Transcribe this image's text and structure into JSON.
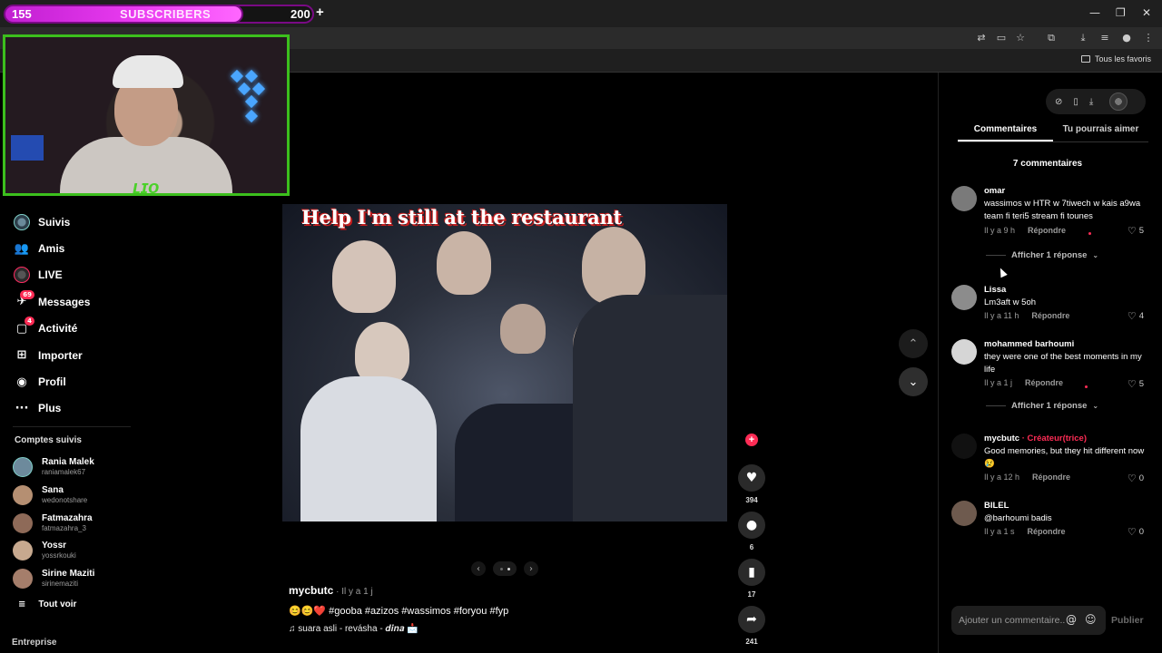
{
  "overlay": {
    "sub_start": "155",
    "sub_label": "SUBSCRIBERS",
    "sub_goal": "200",
    "sub_plus": "+"
  },
  "browser": {
    "bookmark_all": "Tous les favoris",
    "window_controls": [
      "—",
      "❐",
      "✕"
    ]
  },
  "sidebar": {
    "items": [
      {
        "label": "Suivis",
        "icon": "following-avatar-icon"
      },
      {
        "label": "Amis",
        "icon": "friends-icon"
      },
      {
        "label": "LIVE",
        "icon": "live-icon"
      },
      {
        "label": "Messages",
        "icon": "messages-icon",
        "badge": "69"
      },
      {
        "label": "Activité",
        "icon": "activity-icon",
        "badge": "4"
      },
      {
        "label": "Importer",
        "icon": "upload-icon"
      },
      {
        "label": "Profil",
        "icon": "profile-icon"
      },
      {
        "label": "Plus",
        "icon": "more-icon"
      }
    ],
    "following_title": "Comptes suivis",
    "following": [
      {
        "name": "Rania Malek",
        "user": "raniamalek67",
        "color": "#6d8a9c"
      },
      {
        "name": "Sana",
        "user": "wedonotshare",
        "color": "#b58f72"
      },
      {
        "name": "Fatmazahra",
        "user": "fatmazahra_3",
        "color": "#8e6a58"
      },
      {
        "name": "Yossr",
        "user": "yossrkouki",
        "color": "#c7a98f"
      },
      {
        "name": "Sirine Maziti",
        "user": "sirinemaziti",
        "color": "#a57e6b"
      }
    ],
    "see_all": "Tout voir",
    "company": "Entreprise"
  },
  "video": {
    "caption": "Help I'm still at the restaurant",
    "author": "mycbutc",
    "time": " · Il y a 1 j",
    "description": "😊😊❤️ #gooba #azizos #wassimos #foryou #fyp",
    "music": "♫  suara asli - revásha - 𝒅𝒊𝒏𝒂 📩",
    "carousel_prev": "‹",
    "carousel_next": "›",
    "slide": 2,
    "slides": 2
  },
  "actions": {
    "likes": "394",
    "comments": "6",
    "saves": "17",
    "shares": "241"
  },
  "panel": {
    "tabs": [
      "Commentaires",
      "Tu pourrais aimer"
    ],
    "comment_count": "7 commentaires",
    "comments": [
      {
        "user": "omar",
        "creator": "",
        "text": "wassimos w HTR w 7tiwech w kais a9wa team fi teri5 stream fi tounes",
        "time": "Il y a 9 h",
        "reply": "Répondre",
        "likes": "5",
        "color": "#7a7a7a"
      },
      {
        "user": "Lissa",
        "creator": "",
        "text": "Lm3aft w 5oh",
        "time": "Il y a 11 h",
        "reply": "Répondre",
        "likes": "4",
        "color": "#8c8c8c"
      },
      {
        "user": "mohammed barhoumi",
        "creator": "",
        "text": "they were one of the best moments in my life",
        "time": "Il y a 1 j",
        "reply": "Répondre",
        "likes": "5",
        "color": "#d6d6d6"
      },
      {
        "user": "mycbutc",
        "creator": " · Créateur(trice)",
        "text": "Good memories, but they hit different now 😢",
        "time": "Il y a 12 h",
        "reply": "Répondre",
        "likes": "0",
        "color": "#111111"
      },
      {
        "user": "BILEL",
        "creator": "",
        "text": "@barhoumi badis",
        "time": "Il y a 1 s",
        "reply": "Répondre",
        "likes": "0",
        "color": "#6e5a4e"
      }
    ],
    "show_reply": "Afficher 1 réponse",
    "comment_placeholder": "Ajouter un commentaire...",
    "publish": "Publier"
  }
}
